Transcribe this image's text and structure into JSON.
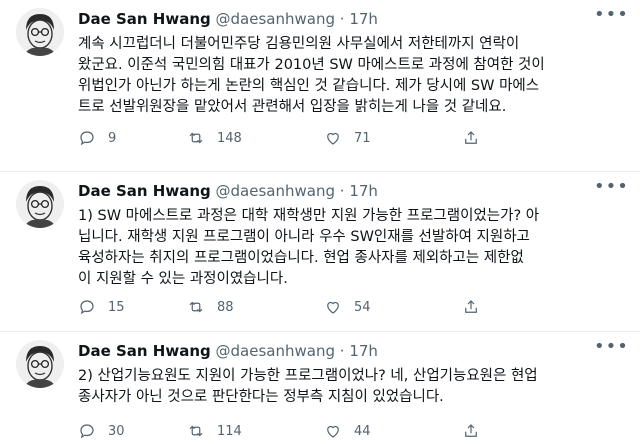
{
  "tweets": [
    {
      "name": "Dae San Hwang",
      "handle": "@daesanhwang",
      "dot": "·",
      "time": "17h",
      "text": "계속 시끄럽더니 더불어민주당 김용민의원 사무실에서 저한테까지 연락이\n왔군요. 이준석 국민의힘 대표가 2010년 SW 마에스트로 과정에 참여한 것이\n위법인가 아닌가 하는게 논란의 핵심인 것 같습니다. 제가 당시에 SW 마에스\n트로 선발위원장을 맡았어서 관련해서 입장을 밝히는게 나을 것 같네요.",
      "replies": "9",
      "retweets": "148",
      "likes": "71"
    },
    {
      "name": "Dae San Hwang",
      "handle": "@daesanhwang",
      "dot": "·",
      "time": "17h",
      "text": "1) SW 마에스트로 과정은 대학 재학생만 지원 가능한 프로그램이었는가? 아\n닙니다. 재학생 지원 프로그램이 아니라 우수 SW인재를 선발하여 지원하고\n육성하자는 취지의 프로그램이었습니다. 현업 종사자를 제외하고는 제한없\n이 지원할 수 있는 과정이였습니다.",
      "replies": "15",
      "retweets": "88",
      "likes": "54"
    },
    {
      "name": "Dae San Hwang",
      "handle": "@daesanhwang",
      "dot": "·",
      "time": "17h",
      "text": "2) 산업기능요원도 지원이 가능한 프로그램이었나? 네, 산업기능요원은 현업\n종사자가 아닌 것으로 판단한다는 정부측 지침이 있었습니다.",
      "replies": "30",
      "retweets": "114",
      "likes": "44"
    }
  ],
  "icons": {
    "more": "more-icon",
    "reply": "reply-icon",
    "retweet": "retweet-icon",
    "like": "like-icon",
    "share": "share-icon"
  },
  "colors": {
    "text": "#0f1419",
    "secondary": "#536471",
    "divider": "#e6ecf0"
  }
}
